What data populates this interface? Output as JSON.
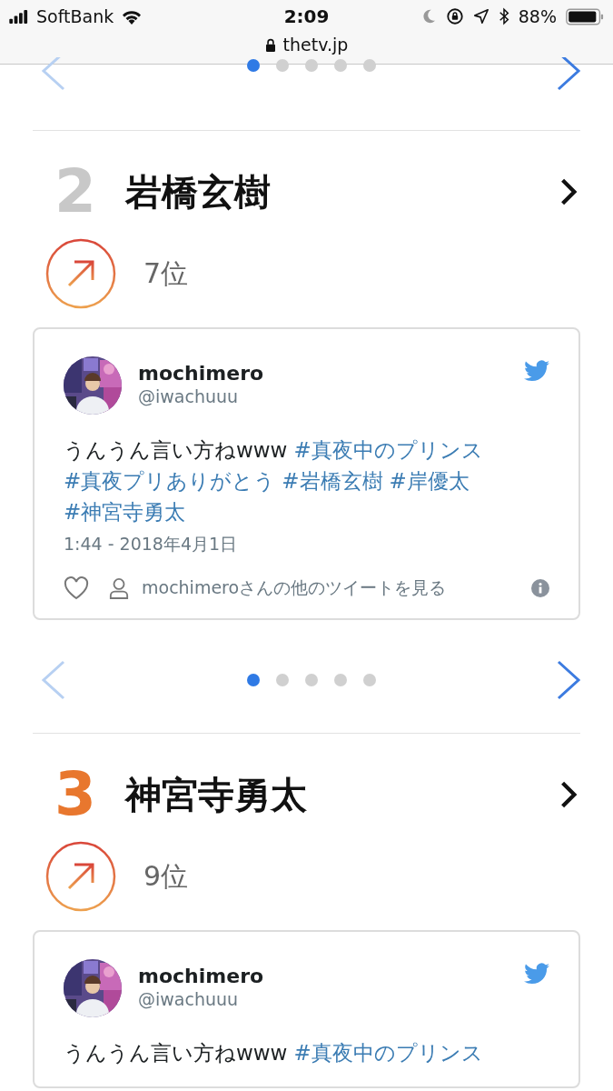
{
  "status_bar": {
    "carrier": "SoftBank",
    "time": "2:09",
    "battery": "88%"
  },
  "address_bar": {
    "url": "thetv.jp"
  },
  "top_carousel": {
    "prev_disabled": true,
    "dots": [
      {
        "selected": true
      },
      {
        "selected": false
      },
      {
        "selected": false
      },
      {
        "selected": false
      },
      {
        "selected": false
      }
    ]
  },
  "entries": [
    {
      "rank": "2",
      "color": "#c8c8c8",
      "name": "岩橋玄樹",
      "trend": {
        "kind": "up",
        "label": "7位"
      },
      "tweet": {
        "user": "mochimero",
        "handle": "@iwachuuu",
        "text": "うんうん言い方ねwww",
        "hashtags": [
          "#真夜中のプリンス",
          "#真夜プリありがとう",
          "#岩橋玄樹",
          "#岸優太",
          "#神宮寺勇太"
        ],
        "time": "1:44 - 2018年4月1日",
        "profile_link": "mochimeroさんの他のツイートを見る"
      },
      "carousel": {
        "prev_disabled": true,
        "dots": [
          {
            "selected": true
          },
          {
            "selected": false
          },
          {
            "selected": false
          },
          {
            "selected": false
          },
          {
            "selected": false
          }
        ]
      }
    },
    {
      "rank": "3",
      "color": "#e8772e",
      "name": "神宮寺勇太",
      "trend": {
        "kind": "up",
        "label": "9位"
      },
      "tweet": {
        "user": "mochimero",
        "handle": "@iwachuuu",
        "text": "うんうん言い方ねwww",
        "hashtags": [
          "#真夜中のプリンス"
        ]
      }
    }
  ]
}
